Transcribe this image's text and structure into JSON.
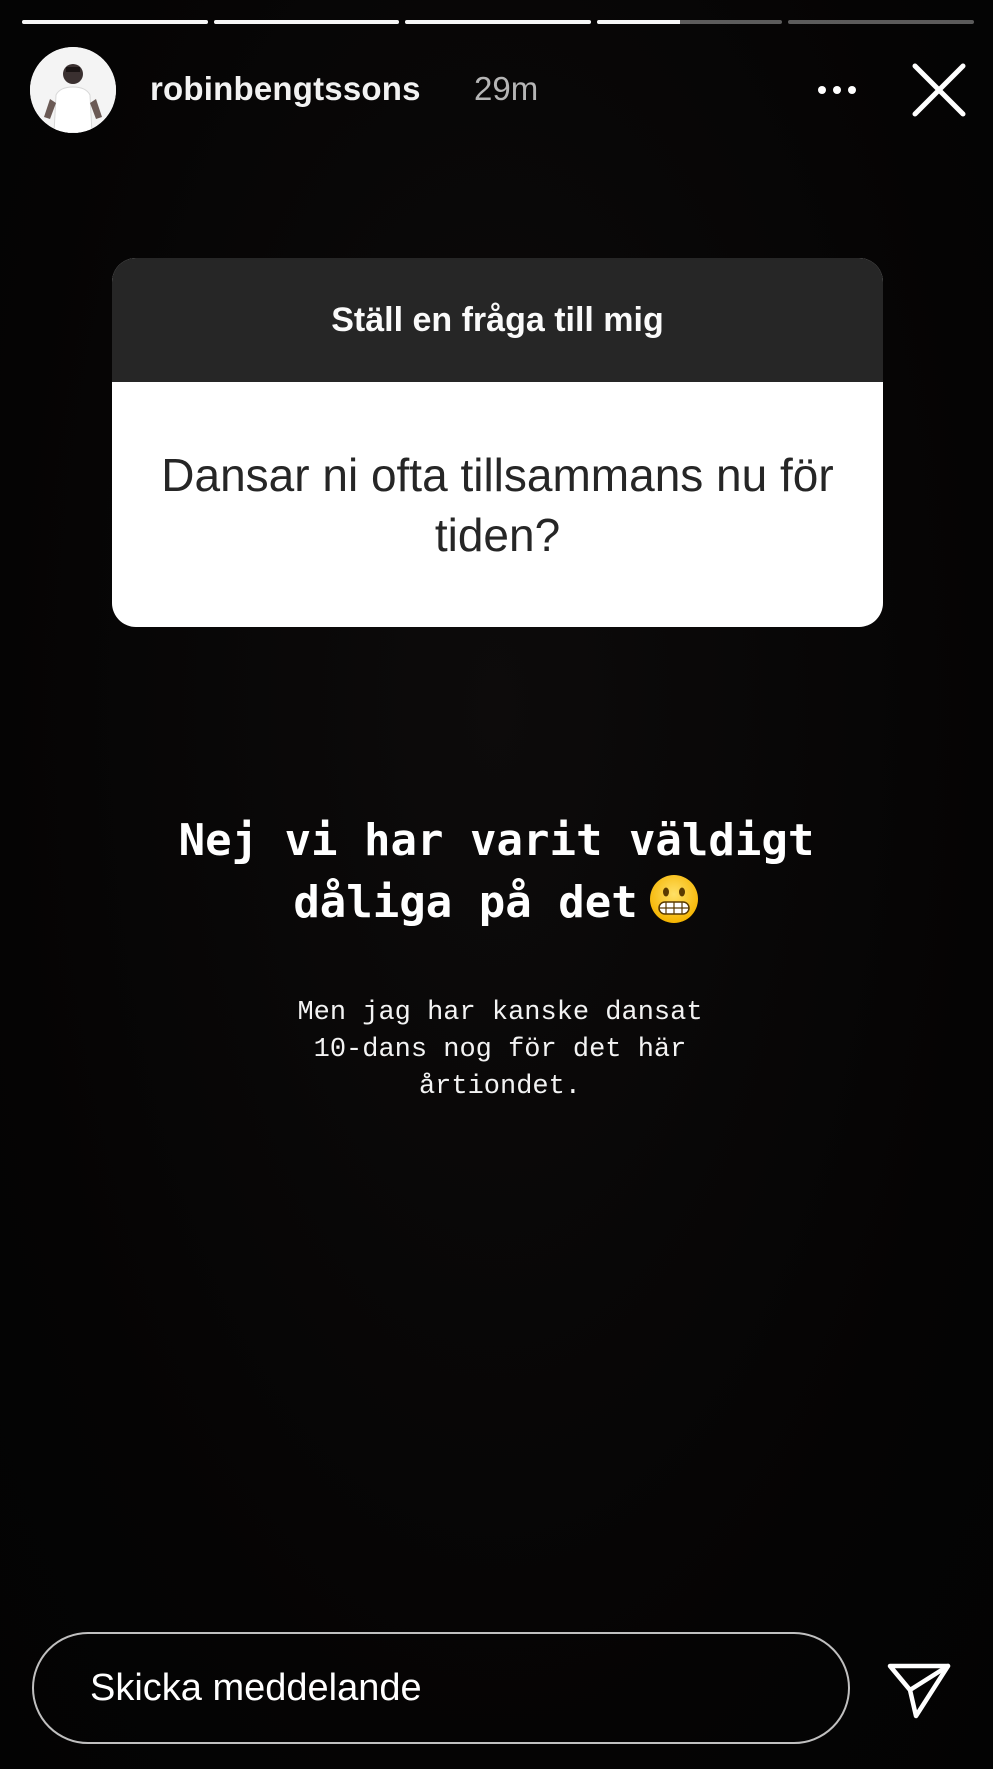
{
  "story": {
    "progress_segments": [
      {
        "fill": 1.0
      },
      {
        "fill": 1.0
      },
      {
        "fill": 1.0
      },
      {
        "fill": 0.45
      },
      {
        "fill": 0.0
      }
    ]
  },
  "header": {
    "username": "robinbengtssons",
    "time_ago": "29m",
    "more_icon": "more-horizontal-icon",
    "close_icon": "close-icon"
  },
  "question_box": {
    "title": "Ställ en fråga till mig",
    "question": "Dansar ni ofta tillsammans nu för tiden?"
  },
  "answer": {
    "main_line1": "Nej vi har varit väldigt",
    "main_line2": "dåliga på det",
    "emoji": "grimacing-face",
    "sub_line1": "Men jag har kanske dansat",
    "sub_line2": "10-dans nog för det här",
    "sub_line3": "årtiondet."
  },
  "footer": {
    "message_placeholder": "Skicka meddelande",
    "send_icon": "send-icon"
  },
  "colors": {
    "background": "#050404",
    "question_header": "#262626",
    "question_body": "#ffffff"
  }
}
